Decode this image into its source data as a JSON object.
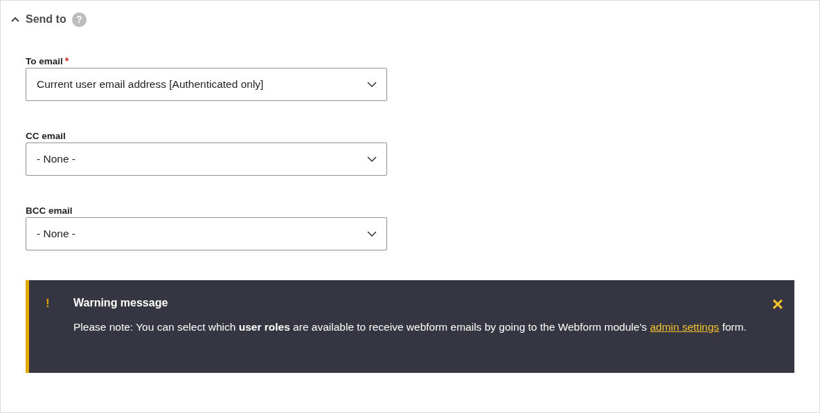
{
  "section": {
    "title": "Send to",
    "expanded": true,
    "help": "?"
  },
  "fields": [
    {
      "label": "To email",
      "required_mark": "*",
      "value": "Current user email address [Authenticated only]"
    },
    {
      "label": "CC email",
      "value": "- None -"
    },
    {
      "label": "BCC email",
      "value": "- None -"
    }
  ],
  "alert": {
    "kind": "warning",
    "icon": "!",
    "title": "Warning message",
    "text_before": "Please note: You can select which **user roles** are available to receive webform emails by going to the Webform module's",
    "link": "admin settings",
    "text_after": "form.",
    "close": "×"
  }
}
